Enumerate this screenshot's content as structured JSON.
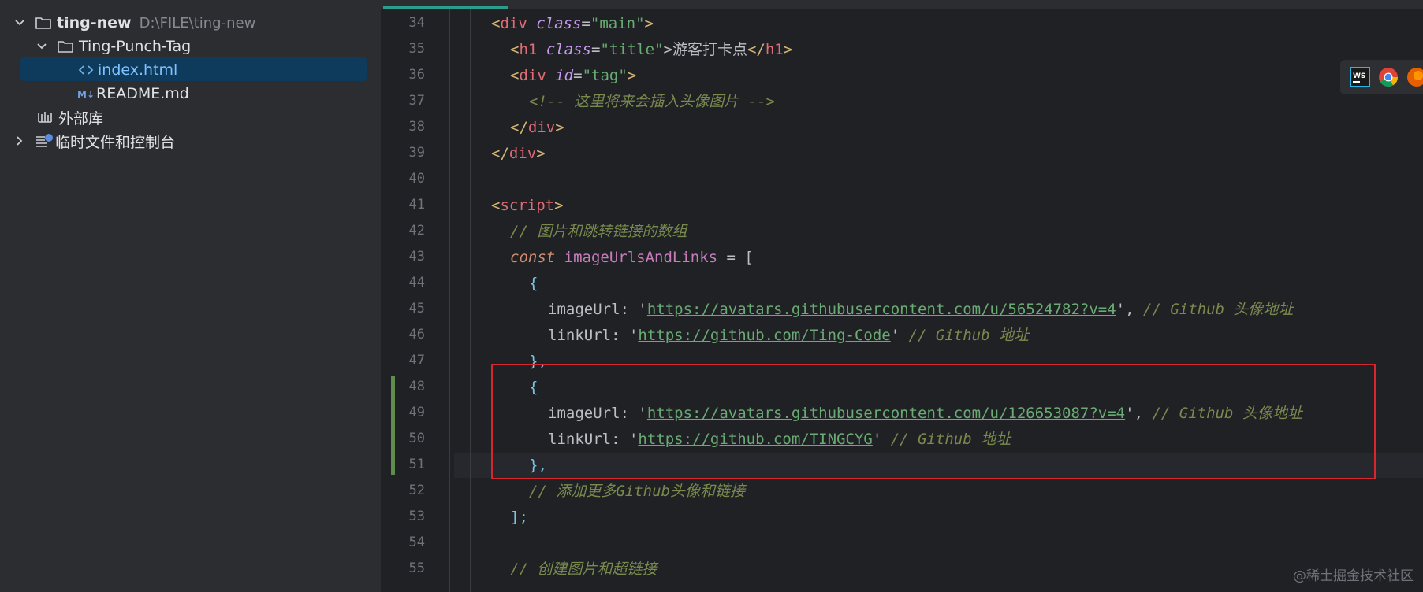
{
  "project_tree": {
    "project_name": "ting-new",
    "project_path": "D:\\FILE\\ting-new",
    "folder": "Ting-Punch-Tag",
    "files": [
      "index.html",
      "README.md"
    ],
    "external_libraries": "外部库",
    "scratches": "临时文件和控制台",
    "selected_file": "index.html"
  },
  "editor": {
    "line_numbers": [
      "34",
      "35",
      "36",
      "37",
      "38",
      "39",
      "40",
      "41",
      "42",
      "43",
      "44",
      "45",
      "46",
      "47",
      "48",
      "49",
      "50",
      "51",
      "52",
      "53",
      "54",
      "55"
    ],
    "code": {
      "l34": {
        "open": "<",
        "tag": "div",
        "attr": " class",
        "eq": "=",
        "val": "\"main\"",
        "close": ">"
      },
      "l35": {
        "open": "<",
        "tag": "h1",
        "attr": " class",
        "eq": "=",
        "val": "\"title\"",
        "text": ">游客打卡点",
        "endopen": "</",
        "endtag": "h1",
        "close": ">"
      },
      "l36": {
        "open": "<",
        "tag": "div",
        "attr": " id",
        "eq": "=",
        "val": "\"tag\"",
        "close": ">"
      },
      "l37": {
        "comment": "<!-- 这里将来会插入头像图片 -->"
      },
      "l38": {
        "open": "</",
        "tag": "div",
        "close": ">"
      },
      "l39": {
        "open": "</",
        "tag": "div",
        "close": ">"
      },
      "l41": {
        "open": "<",
        "tag": "script",
        "close": ">"
      },
      "l42": {
        "comment": "// 图片和跳转链接的数组"
      },
      "l43": {
        "kw": "const",
        "name": " imageUrlsAndLinks",
        "rest": " = ["
      },
      "l44": {
        "brace": "{"
      },
      "l45": {
        "prop": "imageUrl",
        "colon": ": '",
        "url": "https://avatars.githubusercontent.com/u/56524782?v=4",
        "end": "',",
        "comment": " // Github 头像地址"
      },
      "l46": {
        "prop": "linkUrl",
        "colon": ": '",
        "url": "https://github.com/Ting-Code",
        "end": "'",
        "comment": " // Github 地址"
      },
      "l47": {
        "brace": "},"
      },
      "l48": {
        "brace": "{"
      },
      "l49": {
        "prop": "imageUrl",
        "colon": ": '",
        "url": "https://avatars.githubusercontent.com/u/126653087?v=4",
        "end": "',",
        "comment": " // Github 头像地址"
      },
      "l50": {
        "prop": "linkUrl",
        "colon": ": '",
        "url": "https://github.com/TINGCYG",
        "end": "'",
        "comment": " // Github 地址"
      },
      "l51": {
        "brace": "},"
      },
      "l52": {
        "comment": "// 添加更多Github头像和链接"
      },
      "l53": {
        "text": "];"
      },
      "l55": {
        "comment": "// 创建图片和超链接"
      }
    }
  },
  "browser_icons": [
    "webstorm-icon",
    "chrome-icon",
    "firefox-icon"
  ],
  "watermark": "@稀土掘金技术社区",
  "colors": {
    "selection": "#0e3a5b",
    "highlight_box": "#d7262e",
    "change_bar": "#5f8d4e"
  }
}
